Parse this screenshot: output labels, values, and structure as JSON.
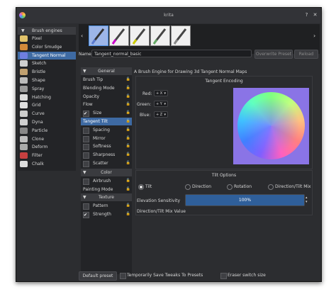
{
  "window": {
    "title": "krita"
  },
  "sidebar": {
    "header": "Brush engines",
    "items": [
      {
        "label": "Pixel",
        "color": "#e1c26a"
      },
      {
        "label": "Color Smudge",
        "color": "#d38a3a"
      },
      {
        "label": "Tangent Normal",
        "color": "#6f7fe0"
      },
      {
        "label": "Sketch",
        "color": "#cfcfcf"
      },
      {
        "label": "Bristle",
        "color": "#c0a070"
      },
      {
        "label": "Shape",
        "color": "#bbbbbb"
      },
      {
        "label": "Spray",
        "color": "#9a9a9a"
      },
      {
        "label": "Hatching",
        "color": "#dddddd"
      },
      {
        "label": "Grid",
        "color": "#e0e0e0"
      },
      {
        "label": "Curve",
        "color": "#cccccc"
      },
      {
        "label": "Dyna",
        "color": "#d0d0d0"
      },
      {
        "label": "Particle",
        "color": "#888888"
      },
      {
        "label": "Clone",
        "color": "#bdbdbd"
      },
      {
        "label": "Deform",
        "color": "#aaaaaa"
      },
      {
        "label": "Filter",
        "color": "#c74040"
      },
      {
        "label": "Chalk",
        "color": "#dddddd"
      }
    ]
  },
  "presets": {
    "nav_left": "‹",
    "nav_right": "›"
  },
  "name_row": {
    "label": "Name:",
    "value": "Tangent_normal_basic",
    "overwrite": "Overwrite Preset",
    "reload": "Reload"
  },
  "options": {
    "general_header": "General",
    "items": [
      {
        "label": "Brush Tip",
        "check": null
      },
      {
        "label": "Blending Mode",
        "check": null
      },
      {
        "label": "Opacity",
        "check": null
      },
      {
        "label": "Flow",
        "check": null
      },
      {
        "label": "Size",
        "check": true
      },
      {
        "label": "Tangent Tilt",
        "check": null
      },
      {
        "label": "Spacing",
        "check": false
      },
      {
        "label": "Mirror",
        "check": false
      },
      {
        "label": "Softness",
        "check": false
      },
      {
        "label": "Sharpness",
        "check": false
      },
      {
        "label": "Scatter",
        "check": false
      },
      {
        "label": "Rotation",
        "check": false
      }
    ],
    "color_header": "Color",
    "color_items": [
      {
        "label": "Airbrush",
        "check": false
      },
      {
        "label": "Painting Mode",
        "check": null
      }
    ],
    "texture_header": "Texture",
    "texture_items": [
      {
        "label": "Pattern",
        "check": false
      },
      {
        "label": "Strength",
        "check": true
      }
    ]
  },
  "settings": {
    "description": "A Brush Engine for Drawing 3d Tangent Normal Maps",
    "encoding_title": "Tangent Encoding",
    "red_label": "Red:",
    "red_value": "+ X",
    "green_label": "Green:",
    "green_value": "+ Y",
    "blue_label": "Blue:",
    "blue_value": "+ Z",
    "tilt_title": "Tilt Options",
    "radio_tilt": "Tilt",
    "radio_direction": "Direction",
    "radio_rotation": "Rotation",
    "radio_mix": "Direction/Tilt Mix",
    "elevation_label": "Elevation Sensitivity",
    "elevation_value": "100%",
    "elevation_fraction": 1.0,
    "mix_label": "Direction/Tilt Mix Value"
  },
  "footer": {
    "default_preset": "Default preset",
    "temp_save": "Temporarily Save Tweaks To Presets",
    "eraser": "Eraser switch size"
  },
  "colors": {
    "accent": "#3e6aa3",
    "bg": "#2c2d30"
  }
}
